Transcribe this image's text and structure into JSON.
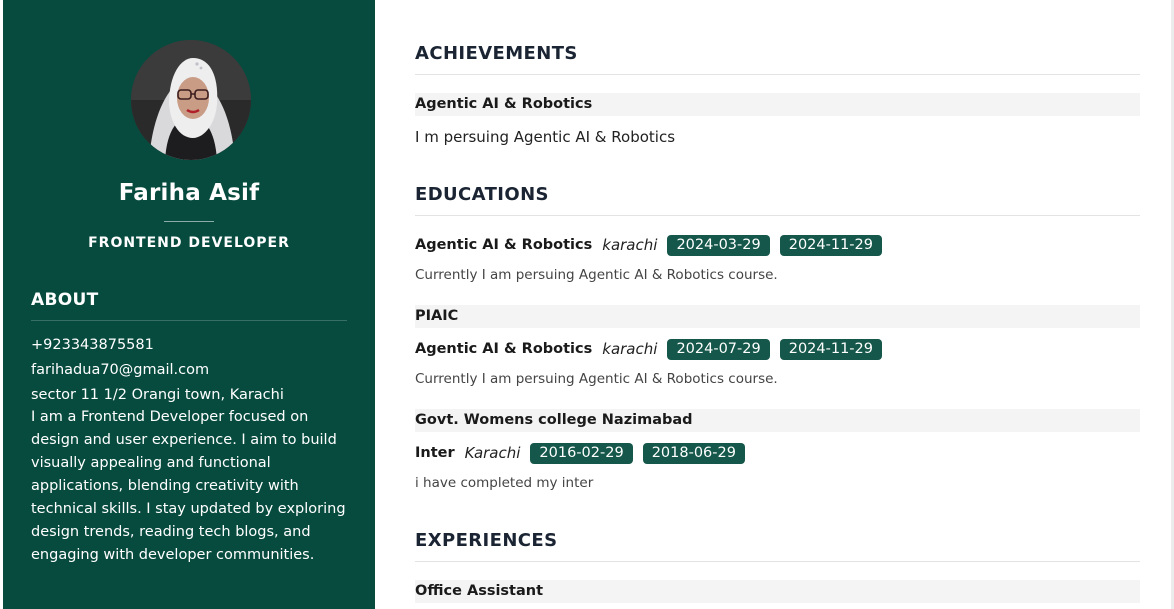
{
  "profile": {
    "name": "Fariha Asif",
    "role": "FRONTEND DEVELOPER"
  },
  "about": {
    "heading": "ABOUT",
    "phone": "+923343875581",
    "email": "farihadua70@gmail.com",
    "address": "sector 11 1/2 Orangi town, Karachi",
    "bio": "I am a Frontend Developer focused on design and user experience. I aim to build visually appealing and functional applications, blending creativity with technical skills. I stay updated by exploring design trends, reading tech blogs, and engaging with developer communities."
  },
  "achievements": {
    "heading": "ACHIEVEMENTS",
    "items": [
      {
        "title": "Agentic AI & Robotics",
        "description": "I m persuing Agentic AI & Robotics"
      }
    ]
  },
  "educations": {
    "heading": "EDUCATIONS",
    "items": [
      {
        "course": "Agentic AI & Robotics",
        "location": "karachi",
        "start": "2024-03-29",
        "end": "2024-11-29",
        "description": "Currently I am persuing Agentic AI & Robotics course."
      },
      {
        "institution": "PIAIC",
        "course": "Agentic AI & Robotics",
        "location": "karachi",
        "start": "2024-07-29",
        "end": "2024-11-29",
        "description": "Currently I am persuing Agentic AI & Robotics course."
      },
      {
        "institution": "Govt. Womens college Nazimabad",
        "course": "Inter",
        "location": "Karachi",
        "start": "2016-02-29",
        "end": "2018-06-29",
        "description": "i have completed my inter"
      }
    ]
  },
  "experiences": {
    "heading": "EXPERIENCES",
    "items": [
      {
        "title": "Office Assistant"
      }
    ]
  },
  "colors": {
    "sidebar": "#074b3f",
    "chip": "#15574a",
    "band": "#f4f4f4",
    "heading": "#1a2433"
  }
}
